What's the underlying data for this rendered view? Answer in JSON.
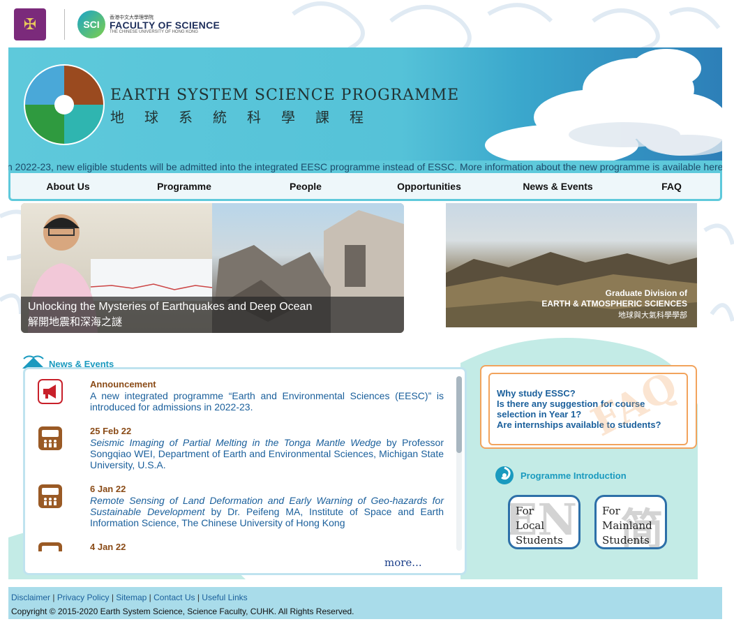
{
  "header": {
    "cuhk_crest_icon": "cuhk-crest-icon",
    "faculty_badge": "SCI",
    "faculty_ch": "香港中文大學理學院",
    "faculty_en": "FACULTY OF SCIENCE",
    "faculty_sub": "THE CHINESE UNIVERSITY OF HONG KONG"
  },
  "banner": {
    "title_en": "EARTH SYSTEM SCIENCE PROGRAMME",
    "title_ch": "地球系統科學課程"
  },
  "marquee": {
    "text": "n 2022-23, new eligible students will be admitted into the integrated EESC programme instead of ESSC. More information about the new programme is available here"
  },
  "nav": {
    "items": [
      {
        "label": "About Us"
      },
      {
        "label": "Programme"
      },
      {
        "label": "People"
      },
      {
        "label": "Opportunities"
      },
      {
        "label": "News & Events"
      },
      {
        "label": "FAQ"
      }
    ]
  },
  "feature": {
    "caption_en": "Unlocking the Mysteries of Earthquakes and Deep Ocean",
    "caption_ch": "解開地震和深海之謎"
  },
  "graduate": {
    "line1": "Graduate Division of",
    "line2": "EARTH & ATMOSPHERIC SCIENCES",
    "line3": "地球與大氣科學學部"
  },
  "news": {
    "heading": "News & Events",
    "more": "more...",
    "items": [
      {
        "date": "Announcement",
        "text": "A new integrated programme “Earth and Environmental Sciences (EESC)” is introduced for admissions in 2022-23."
      },
      {
        "date": "25 Feb 22",
        "title": "Seismic Imaging of Partial Melting in the Tonga Mantle Wedge",
        "text": " by Professor Songqiao WEI, Department of Earth and Environmental Sciences, Michigan State University, U.S.A."
      },
      {
        "date": "6 Jan 22",
        "title": "Remote Sensing of Land Deformation and Early Warning of Geo-hazards for Sustainable Development",
        "text": " by Dr. Peifeng MA, Institute of Space and Earth Information Science, The Chinese University of Hong Kong"
      },
      {
        "date": "4 Jan 22"
      }
    ]
  },
  "faq": {
    "watermark": "FAQ",
    "questions": [
      "Why study ESSC?",
      "Is there any suggestion for course selection in Year 1?",
      "Are internships available to students?"
    ]
  },
  "programme": {
    "heading": "Programme Introduction",
    "local": {
      "line1": "For",
      "line2": "Local",
      "line3": "Students",
      "watermark": "EN"
    },
    "mainland": {
      "line1": "For",
      "line2": "Mainland",
      "line3": "Students",
      "watermark": "简"
    }
  },
  "footer": {
    "links": [
      "Disclaimer",
      "Privacy Policy",
      "Sitemap",
      "Contact Us",
      "Useful Links"
    ],
    "copyright": "Copyright © 2015-2020 Earth System Science, Science Faculty, CUHK. All Rights Reserved."
  },
  "colors": {
    "accent": "#5ec9db",
    "link": "#1a5f9b",
    "date": "#8a4b17",
    "faq_border": "#f2a35c"
  }
}
